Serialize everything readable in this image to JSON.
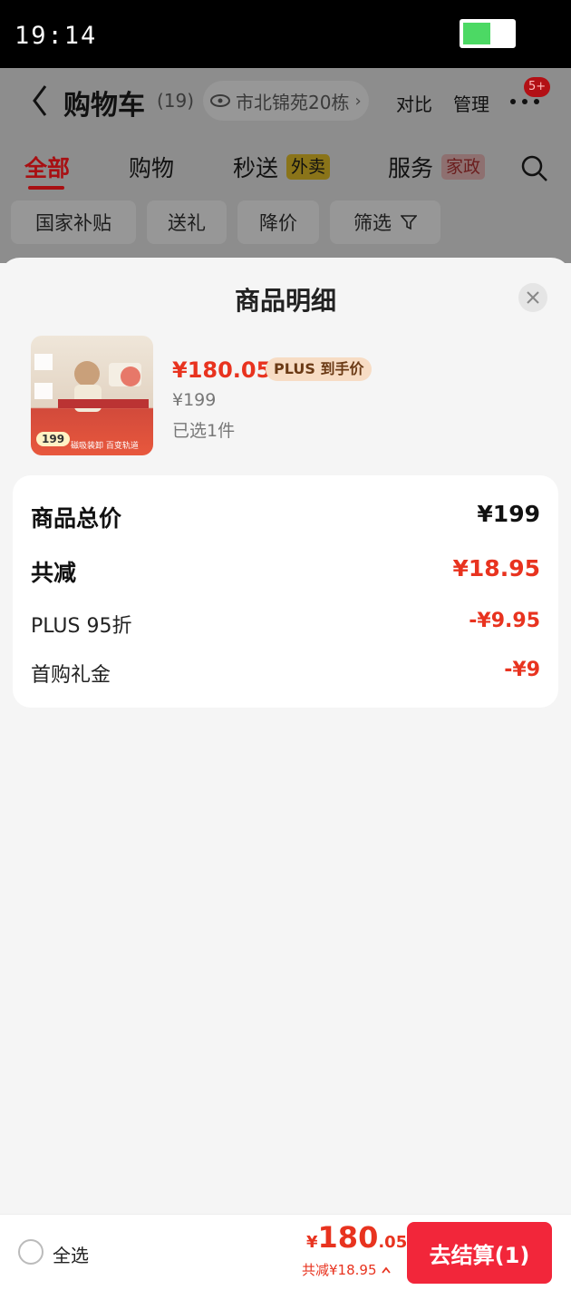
{
  "status_bar": {
    "time": "19:14"
  },
  "cart_header": {
    "title": "购物车",
    "count": "(19)",
    "location": "市北锦苑20栋",
    "compare": "对比",
    "manage": "管理",
    "more_badge": "5+"
  },
  "tabs": [
    {
      "label": "全部",
      "active": true
    },
    {
      "label": "购物"
    },
    {
      "label": "秒送",
      "tag": "外卖"
    },
    {
      "label": "服务",
      "tag": "家政"
    }
  ],
  "filters": [
    "国家补贴",
    "送礼",
    "降价",
    "筛选"
  ],
  "sheet": {
    "title": "商品明细",
    "product": {
      "price": "¥180.05",
      "plus_tag": "PLUS 到手价",
      "original_price": "¥199",
      "selected": "已选1件",
      "thumb_badge": "199",
      "thumb_caption": "磁吸装卸 百变轨道"
    },
    "summary": {
      "total_label": "商品总价",
      "total_value": "¥199",
      "reduce_label": "共减",
      "reduce_value": "¥18.95",
      "items": [
        {
          "label": "PLUS 95折",
          "value": "-¥9.95"
        },
        {
          "label": "首购礼金",
          "value": "-¥9"
        }
      ]
    }
  },
  "bottom_bar": {
    "select_all": "全选",
    "currency": "¥",
    "total_int": "180",
    "total_dec": ".05",
    "reduce_text": "共减¥18.95",
    "checkout": "去结算(1)"
  },
  "colors": {
    "accent": "#e8331f",
    "checkout": "#f2263a",
    "plus_tag_bg": "#f7dcc4"
  }
}
